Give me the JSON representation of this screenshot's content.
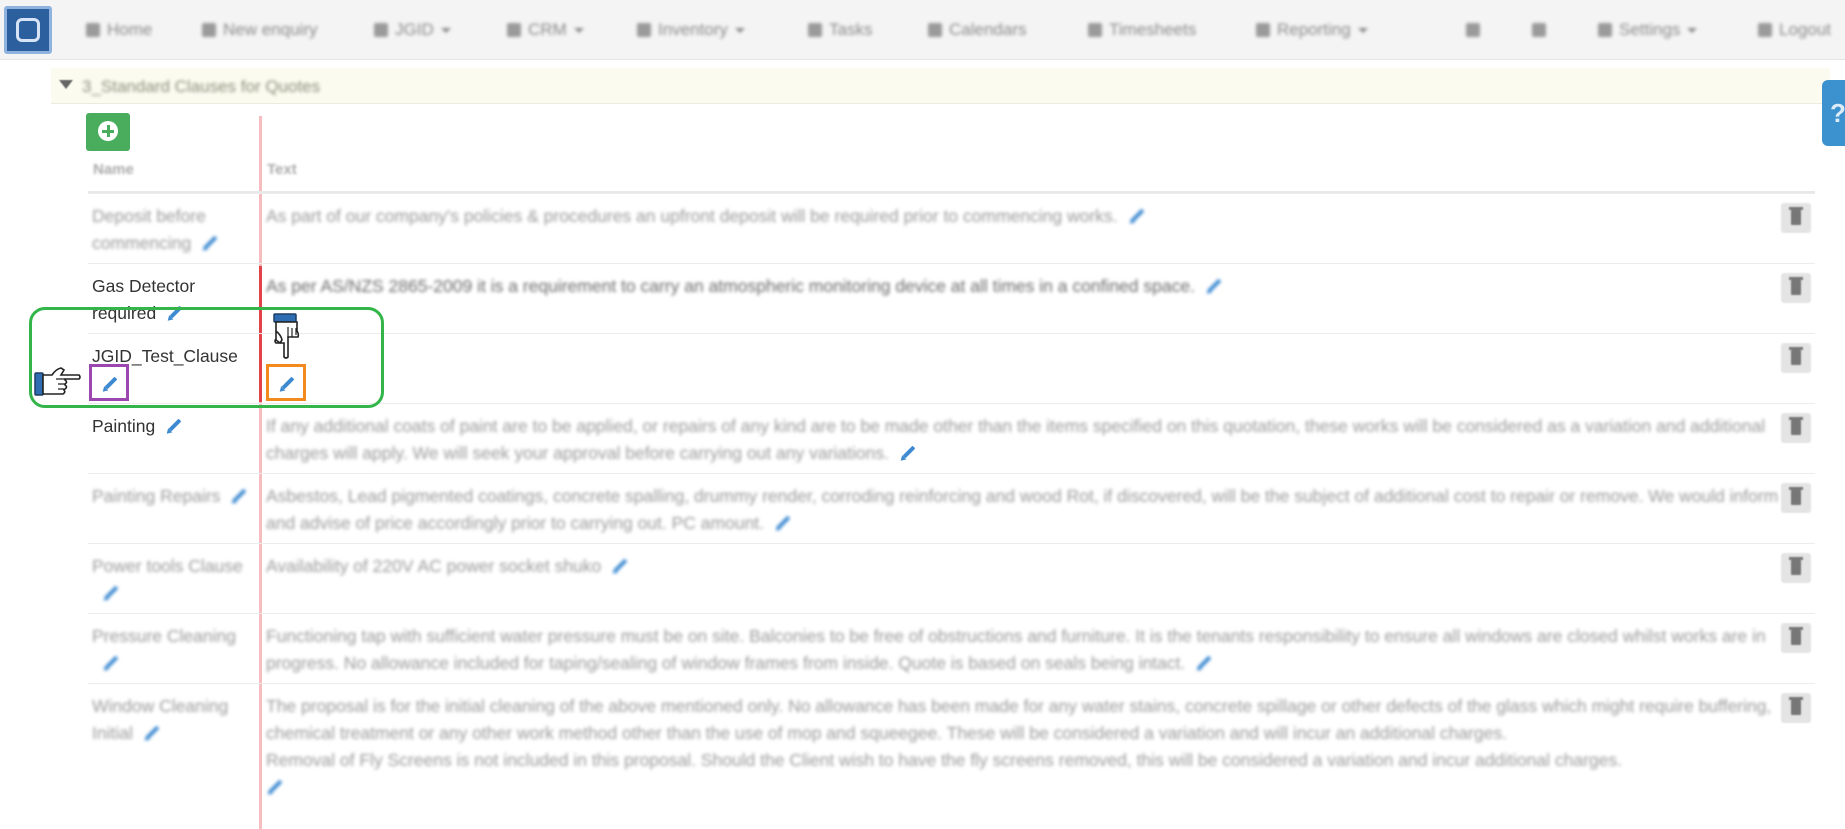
{
  "navbar": {
    "items": [
      {
        "label": "Home",
        "icon": "home-icon"
      },
      {
        "label": "New enquiry",
        "icon": "phone-icon"
      },
      {
        "label": "JGID",
        "icon": "table-icon",
        "dropdown": true
      },
      {
        "label": "CRM",
        "icon": "users-icon",
        "dropdown": true
      },
      {
        "label": "Inventory",
        "icon": "sitemap-icon",
        "dropdown": true
      },
      {
        "label": "Tasks",
        "icon": "check-icon"
      },
      {
        "label": "Calendars",
        "icon": "calendar-icon"
      },
      {
        "label": "Timesheets",
        "icon": "clock-icon"
      },
      {
        "label": "Reporting",
        "icon": "bar-chart-icon",
        "dropdown": true
      },
      {
        "label": "",
        "icon": "search-icon"
      },
      {
        "label": "",
        "icon": "globe-icon"
      },
      {
        "label": "Settings",
        "icon": "gear-icon",
        "dropdown": true
      },
      {
        "label": "Logout",
        "icon": "logout-icon"
      }
    ]
  },
  "section": {
    "title": "3_Standard Clauses for Quotes"
  },
  "table": {
    "headers": {
      "name": "Name",
      "text": "Text"
    },
    "rows": [
      {
        "name": "Deposit before commencing",
        "text": [
          "As part of our company's policies & procedures an upfront deposit will be required prior to commencing works."
        ]
      },
      {
        "name": "Gas Detector required",
        "text": [
          "As per AS/NZS 2865-2009 it is a requirement to carry an atmospheric monitoring device at all times in a confined space."
        ]
      },
      {
        "name": "JGID_Test_Clause",
        "text": []
      },
      {
        "name": "Painting",
        "text": [
          "If any additional coats of paint are to be applied, or repairs of any kind are to be made other than the items specified on this quotation, these works will be considered as a variation and additional charges will apply. We will seek your approval before carrying out any variations."
        ]
      },
      {
        "name": "Painting Repairs",
        "text": [
          "Asbestos, Lead pigmented coatings, concrete spalling, drummy render, corroding reinforcing and wood Rot, if discovered, will be the subject of additional cost to repair or remove. We would inform and advise of price accordingly prior to carrying out. PC amount."
        ]
      },
      {
        "name": "Power tools Clause",
        "text": [
          "Availability of 220V AC power socket shuko"
        ]
      },
      {
        "name": "Pressure Cleaning",
        "text": [
          "Functioning tap with sufficient water pressure must be on site. Balconies to be free of obstructions and furniture. It is the tenants responsibility to ensure all windows are closed whilst works are in progress. No allowance included for taping/sealing of window frames from inside. Quote is based on seals being intact."
        ]
      },
      {
        "name": "Window Cleaning Initial",
        "text": [
          "The proposal is for the initial cleaning of the above mentioned only. No allowance has been made for any water stains, concrete spillage or other defects of the glass which might require buffering, chemical treatment or any other work method other than the use of mop and squeegee. These will be considered a variation and will incur an additional charges.",
          "Removal of Fly Screens is not included in this proposal. Should the Client wish to have the fly screens removed, this will be considered a variation and incur additional charges."
        ]
      }
    ]
  },
  "colors": {
    "accent": "#3d8ad1",
    "add_button": "#49ad5d",
    "highlight": "#33b54a",
    "name_edit_marker": "#9c46b0",
    "text_edit_marker": "#f28a1d",
    "divider": "#e2434b"
  }
}
